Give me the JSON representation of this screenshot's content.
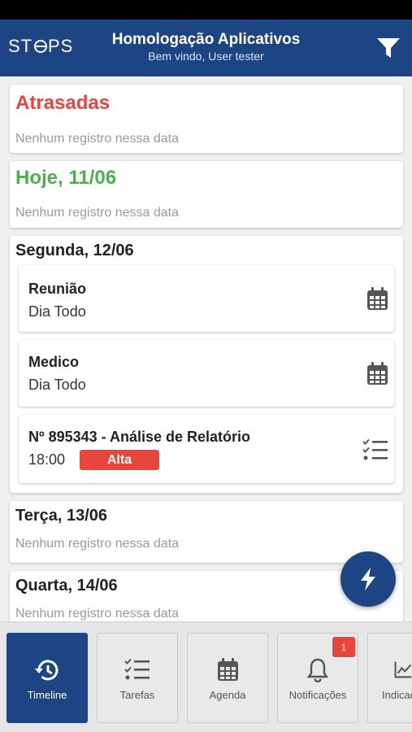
{
  "header": {
    "logo": "STEPS",
    "title": "Homologação Aplicativos",
    "subtitle": "Bem vindo, User tester",
    "filter_icon": "filter-icon"
  },
  "sections": {
    "late": {
      "title": "Atrasadas",
      "empty": "Nenhum registro nessa data"
    },
    "today": {
      "title": "Hoje, 11/06",
      "empty": "Nenhum registro nessa data"
    },
    "monday": {
      "title": "Segunda, 12/06",
      "items": [
        {
          "title": "Reunião",
          "subtitle": "Dia Todo",
          "icon": "calendar-icon"
        },
        {
          "title": "Medico",
          "subtitle": "Dia Todo",
          "icon": "calendar-icon"
        },
        {
          "title": "Nº 895343 - Análise de Relatório",
          "subtitle": "18:00",
          "badge": "Alta",
          "icon": "task-list-icon"
        }
      ]
    },
    "tuesday": {
      "title": "Terça, 13/06",
      "empty": "Nenhum registro nessa data"
    },
    "wednesday": {
      "title": "Quarta, 14/06",
      "empty": "Nenhum registro nessa data"
    }
  },
  "fab": {
    "icon": "lightning-icon"
  },
  "bottom_nav": [
    {
      "label": "Timeline",
      "icon": "history-icon",
      "active": true
    },
    {
      "label": "Tarefas",
      "icon": "task-list-icon"
    },
    {
      "label": "Agenda",
      "icon": "calendar-icon"
    },
    {
      "label": "Notificações",
      "icon": "bell-icon",
      "badge": "1"
    },
    {
      "label": "Indicad",
      "icon": "chart-icon"
    }
  ],
  "colors": {
    "primary": "#1d4583",
    "late": "#e8453c",
    "today": "#4caf50",
    "badge": "#e8453c"
  }
}
